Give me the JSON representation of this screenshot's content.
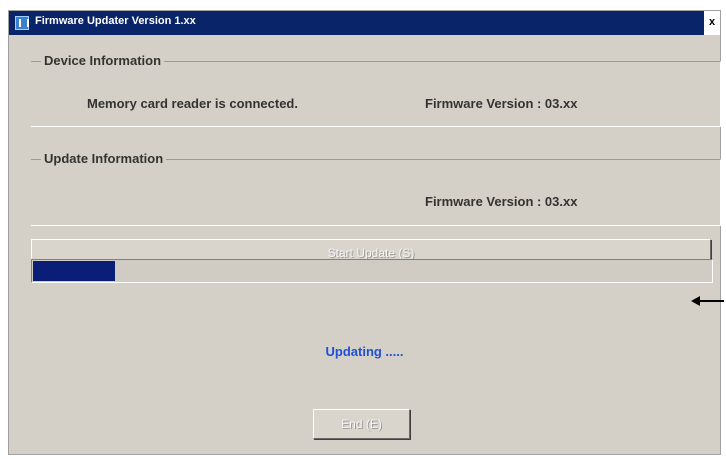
{
  "window": {
    "title": "Firmware Updater Version 1.xx",
    "close_glyph": "x"
  },
  "device_info": {
    "heading": "Device Information",
    "status_text": "Memory card reader is connected.",
    "firmware_text": "Firmware Version : 03.xx"
  },
  "update_info": {
    "heading": "Update Information",
    "firmware_text": "Firmware Version : 03.xx"
  },
  "buttons": {
    "start_update": "Start Update (S)",
    "end": "End (E)"
  },
  "progress": {
    "fraction": 0.12,
    "status_text": "Updating ....."
  },
  "colors": {
    "title_bar": "#0a246a",
    "progress_fill": "#0a1e78",
    "status_text": "#1e4fd8"
  }
}
